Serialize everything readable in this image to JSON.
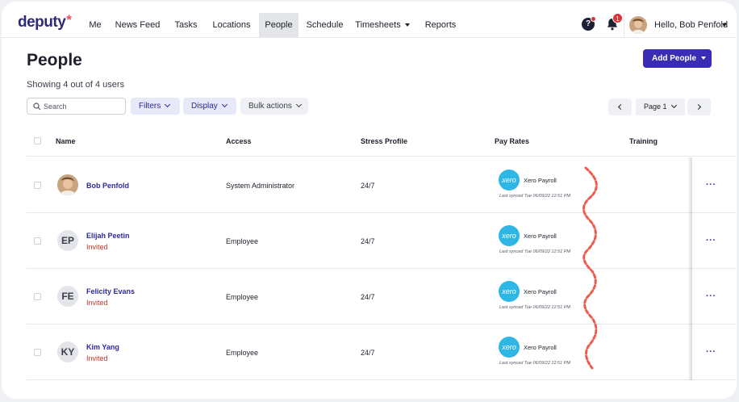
{
  "brand": {
    "logo_text": "deputy",
    "logo_mark": "*",
    "accent": "#3a2cb5",
    "logo_accent": "#ef4b5d"
  },
  "nav": {
    "items": [
      {
        "label": "Me"
      },
      {
        "label": "News Feed"
      },
      {
        "label": "Tasks"
      },
      {
        "label": "Locations"
      },
      {
        "label": "People",
        "active": true
      },
      {
        "label": "Schedule"
      },
      {
        "label": "Timesheets",
        "has_dropdown": true
      },
      {
        "label": "Reports"
      }
    ],
    "notifications_count": "1",
    "help_icon": "help-icon",
    "bell_icon": "bell-icon",
    "user_greeting": "Hello, Bob Penfold"
  },
  "page": {
    "title": "People",
    "add_button": "Add People",
    "showing": "Showing 4 out of 4 users"
  },
  "toolbar": {
    "search_placeholder": "Search",
    "filters": "Filters",
    "display": "Display",
    "bulk_actions": "Bulk actions",
    "page_label": "Page 1"
  },
  "table": {
    "columns": [
      "Name",
      "Access",
      "Stress Profile",
      "Pay Rates",
      "Training"
    ],
    "rows": [
      {
        "name": "Bob Penfold",
        "initials": "",
        "status": "",
        "access": "System Administrator",
        "stress_profile": "24/7",
        "pay_provider": "Xero Payroll",
        "sync_text": "Last synced Tue 06/09/22 12:51 PM"
      },
      {
        "name": "Elijah Peetin",
        "initials": "EP",
        "status": "Invited",
        "access": "Employee",
        "stress_profile": "24/7",
        "pay_provider": "Xero Payroll",
        "sync_text": "Last synced Tue 06/09/22 12:51 PM"
      },
      {
        "name": "Felicity Evans",
        "initials": "FE",
        "status": "Invited",
        "access": "Employee",
        "stress_profile": "24/7",
        "pay_provider": "Xero Payroll",
        "sync_text": "Last synced Tue 06/09/22 12:51 PM"
      },
      {
        "name": "Kim Yang",
        "initials": "KY",
        "status": "Invited",
        "access": "Employee",
        "stress_profile": "24/7",
        "pay_provider": "Xero Payroll",
        "sync_text": "Last synced Tue 06/09/22 12:51 PM"
      }
    ],
    "xero_logo_text": "xero",
    "row_menu": "···"
  }
}
